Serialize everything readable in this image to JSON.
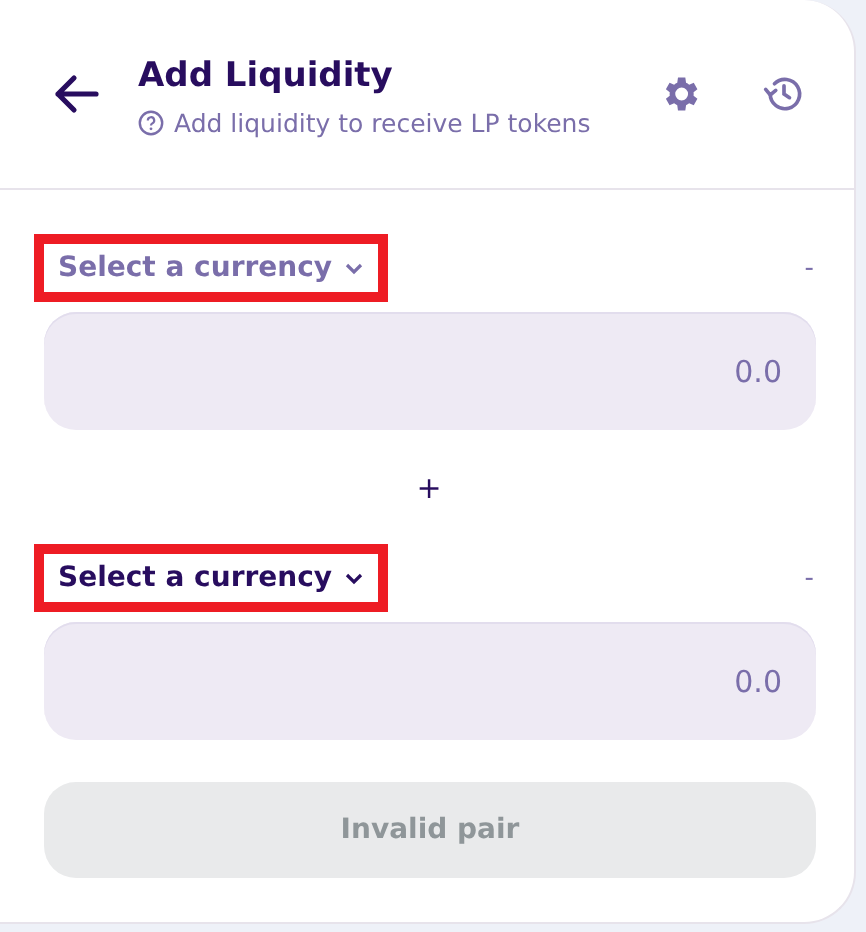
{
  "header": {
    "title": "Add Liquidity",
    "subtitle": "Add liquidity to receive LP tokens"
  },
  "inputs": [
    {
      "select_label": "Select a currency",
      "highlighted": true,
      "muted": true,
      "balance": "-",
      "placeholder": "0.0"
    },
    {
      "select_label": "Select a currency",
      "highlighted": true,
      "muted": false,
      "balance": "-",
      "placeholder": "0.0"
    }
  ],
  "separator": "+",
  "submit": {
    "label": "Invalid pair",
    "disabled": true
  }
}
